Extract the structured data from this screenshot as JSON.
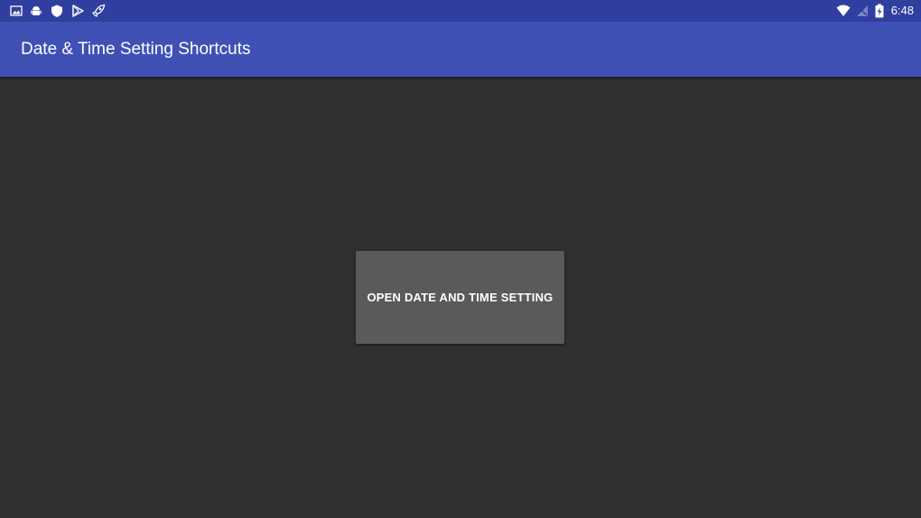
{
  "status_bar": {
    "left_icons": [
      "image-icon",
      "android-icon",
      "shield-icon",
      "play-store-icon",
      "rocket-icon"
    ],
    "right_icons": [
      "wifi-icon",
      "no-signal-icon",
      "battery-charging-icon"
    ],
    "time": "6:48",
    "color": "#303F9F"
  },
  "app_bar": {
    "title": "Date & Time Setting Shortcuts",
    "color": "#3F51B5"
  },
  "main": {
    "button_label": "OPEN DATE AND TIME SETTING",
    "background": "#303030",
    "button_color": "#5A5A5A"
  }
}
